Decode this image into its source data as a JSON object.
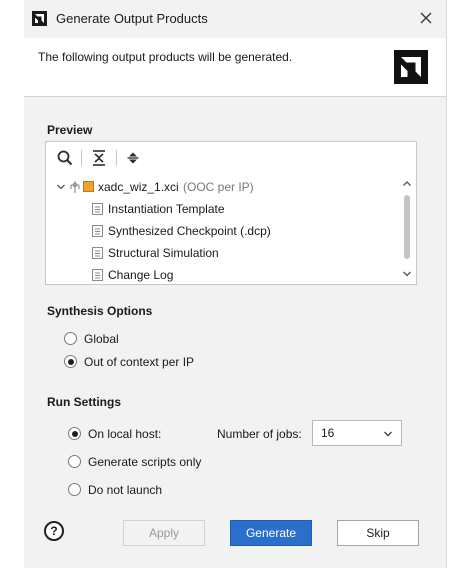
{
  "window": {
    "title": "Generate Output Products"
  },
  "header": {
    "text": "The following output products will be generated."
  },
  "preview": {
    "title": "Preview",
    "tree": {
      "root": {
        "name": "xadc_wiz_1.xci",
        "note": "(OOC per IP)"
      },
      "children": [
        "Instantiation Template",
        "Synthesized Checkpoint (.dcp)",
        "Structural Simulation",
        "Change Log"
      ]
    }
  },
  "synthesis": {
    "title": "Synthesis Options",
    "options": [
      {
        "label": "Global",
        "checked": false
      },
      {
        "label": "Out of context per IP",
        "checked": true
      }
    ]
  },
  "run": {
    "title": "Run Settings",
    "options": [
      {
        "label": "On local host:",
        "checked": true
      },
      {
        "label": "Generate scripts only",
        "checked": false
      },
      {
        "label": "Do not launch",
        "checked": false
      }
    ],
    "jobs_label": "Number of jobs:",
    "jobs_value": "16"
  },
  "buttons": {
    "help": "?",
    "apply": "Apply",
    "generate": "Generate",
    "skip": "Skip"
  },
  "colors": {
    "accent": "#2a6fc9",
    "ip_icon": "#f0a030",
    "dialog_bg": "#f2f2f2"
  }
}
